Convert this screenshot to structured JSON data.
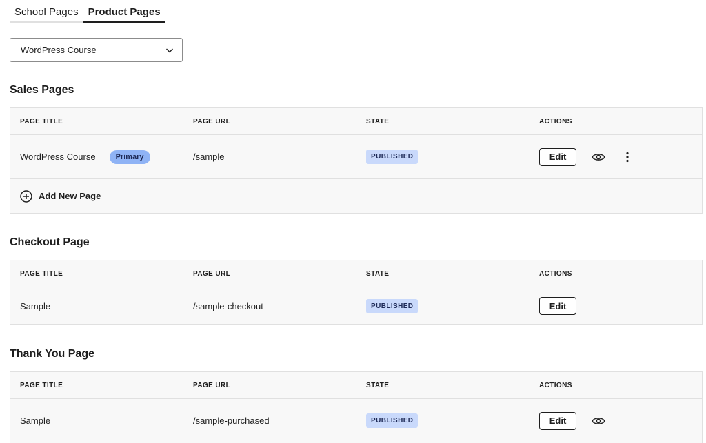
{
  "tabs": [
    {
      "label": "School Pages",
      "active": false
    },
    {
      "label": "Product Pages",
      "active": true
    }
  ],
  "product_select": {
    "value": "WordPress Course"
  },
  "columns": {
    "title": "PAGE TITLE",
    "url": "PAGE URL",
    "state": "STATE",
    "actions": "ACTIONS"
  },
  "sales": {
    "heading": "Sales Pages",
    "rows": [
      {
        "title": "WordPress Course",
        "badge": "Primary",
        "url": "/sample",
        "state": "PUBLISHED",
        "edit": "Edit"
      }
    ],
    "add_label": "Add New Page"
  },
  "checkout": {
    "heading": "Checkout Page",
    "rows": [
      {
        "title": "Sample",
        "url": "/sample-checkout",
        "state": "PUBLISHED",
        "edit": "Edit"
      }
    ]
  },
  "thankyou": {
    "heading": "Thank You Page",
    "rows": [
      {
        "title": "Sample",
        "url": "/sample-purchased",
        "state": "PUBLISHED",
        "edit": "Edit"
      }
    ]
  },
  "icons": {
    "select_chevron": "chevron-down-icon",
    "view": "eye-icon",
    "more": "more-vertical-icon",
    "add": "plus-circle-icon"
  },
  "colors": {
    "primary_badge": "#8fb3f5",
    "published_badge": "#c9d9fb",
    "active_tab_underline": "#1e1e1e"
  }
}
